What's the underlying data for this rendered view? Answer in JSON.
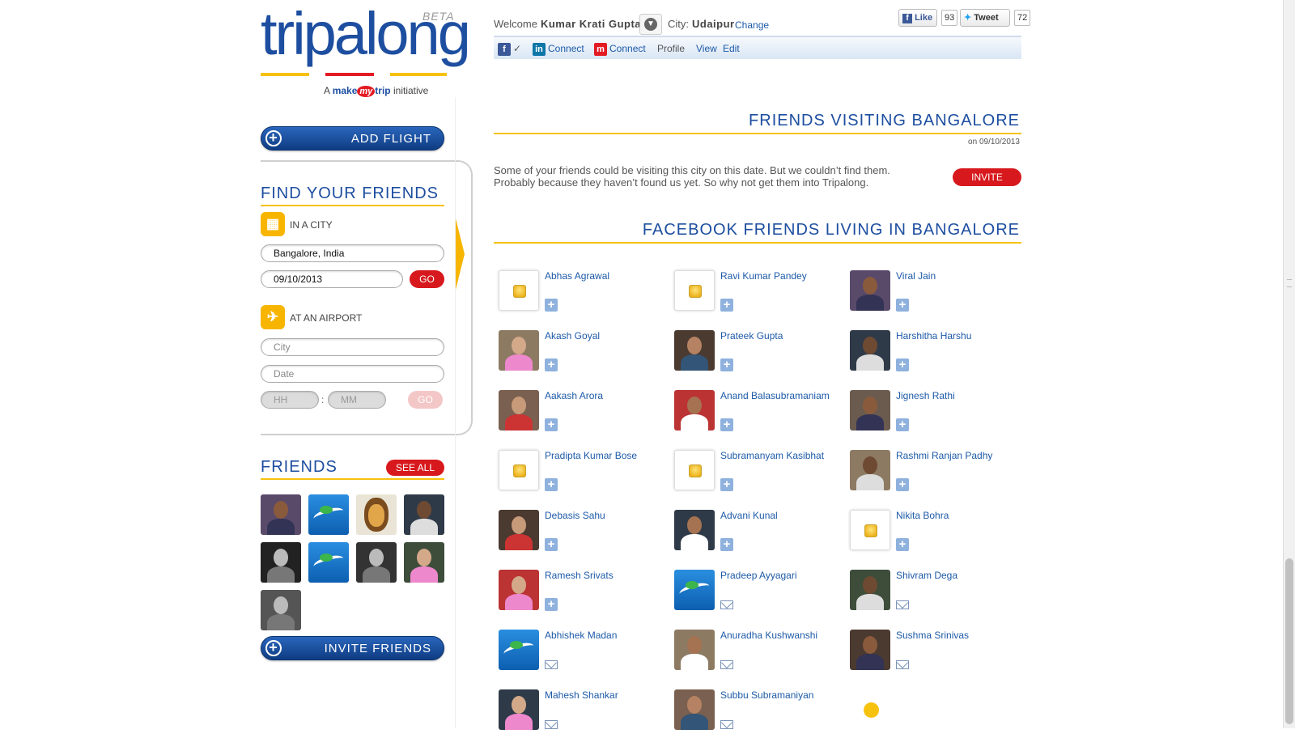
{
  "logo": {
    "word": "tripalong",
    "beta": "BETA",
    "tag_prefix": "A",
    "tag_make": "make",
    "tag_my": "my",
    "tag_trip": "trip",
    "tag_suffix": "initiative"
  },
  "colors": {
    "brand_blue": "#1d4ea0",
    "accent_yellow": "#f7c20e",
    "action_red": "#d7191d"
  },
  "sidebar": {
    "add_flight": "ADD FLIGHT",
    "find_title": "FIND YOUR FRIENDS",
    "in_city": {
      "label": "IN A CITY",
      "icon": "building-icon",
      "city_value": "Bangalore, India",
      "date_value": "09/10/2013",
      "go": "GO"
    },
    "at_airport": {
      "label": "AT AN AIRPORT",
      "icon": "airplane-icon",
      "city_placeholder": "City",
      "date_placeholder": "Date",
      "hh_placeholder": "HH",
      "mm_placeholder": "MM",
      "colon": ":",
      "go": "GO"
    },
    "friends_title": "FRIENDS",
    "see_all": "SEE ALL",
    "invite_friends": "INVITE FRIENDS",
    "friend_thumbs": [
      "photo",
      "tripalong-logo",
      "lion-cartoon",
      "photo",
      "photo-bw",
      "tripalong-logo",
      "photo-bw",
      "photo",
      "photo-bald"
    ]
  },
  "header": {
    "welcome": "Welcome",
    "user_name": "Kumar Krati Gupta",
    "city_label": "City:",
    "city_value": "Udaipur",
    "change": "Change",
    "like": "Like",
    "like_count": "93",
    "tweet": "Tweet",
    "tweet_count": "72",
    "check": "✓",
    "connect_linkedin": "Connect",
    "connect_mmt": "Connect",
    "profile": "Profile",
    "view": "View",
    "edit": "Edit"
  },
  "visiting": {
    "title": "FRIENDS VISITING BANGALORE",
    "on_date": "on 09/10/2013",
    "message": "Some of your friends could be visiting this city on this date. But we couldn’t find them. Probably because they haven’t found us yet. So why not get them into Tripalong.",
    "invite": "INVITE"
  },
  "living": {
    "title": "FACEBOOK FRIENDS LIVING IN BANGALORE",
    "friends": [
      {
        "name": "Abhas Agrawal",
        "pic": "empty",
        "action": "add"
      },
      {
        "name": "Ravi Kumar Pandey",
        "pic": "empty",
        "action": "add"
      },
      {
        "name": "Viral Jain",
        "pic": "photo",
        "action": "add"
      },
      {
        "name": "Akash Goyal",
        "pic": "photo",
        "action": "add"
      },
      {
        "name": "Prateek Gupta",
        "pic": "photo",
        "action": "add"
      },
      {
        "name": "Harshitha Harshu",
        "pic": "photo",
        "action": "add"
      },
      {
        "name": "Aakash Arora",
        "pic": "photo",
        "action": "add"
      },
      {
        "name": "Anand Balasubramaniam",
        "pic": "photo",
        "action": "add"
      },
      {
        "name": "Jignesh Rathi",
        "pic": "photo",
        "action": "add"
      },
      {
        "name": "Pradipta Kumar Bose",
        "pic": "empty",
        "action": "add"
      },
      {
        "name": "Subramanyam Kasibhat",
        "pic": "empty",
        "action": "add"
      },
      {
        "name": "Rashmi Ranjan Padhy",
        "pic": "photo",
        "action": "add"
      },
      {
        "name": "Debasis Sahu",
        "pic": "photo",
        "action": "add"
      },
      {
        "name": "Advani Kunal",
        "pic": "photo",
        "action": "add"
      },
      {
        "name": "Nikita Bohra",
        "pic": "empty",
        "action": "add"
      },
      {
        "name": "Ramesh Srivats",
        "pic": "photo",
        "action": "add"
      },
      {
        "name": "Pradeep Ayyagari",
        "pic": "tripalong-logo",
        "action": "mail"
      },
      {
        "name": "Shivram Dega",
        "pic": "photo",
        "action": "mail"
      },
      {
        "name": "Abhishek Madan",
        "pic": "tripalong-logo",
        "action": "mail"
      },
      {
        "name": "Anuradha Kushwanshi",
        "pic": "photo",
        "action": "mail"
      },
      {
        "name": "Sushma Srinivas",
        "pic": "photo",
        "action": "mail"
      },
      {
        "name": "Mahesh Shankar",
        "pic": "photo",
        "action": "mail"
      },
      {
        "name": "Subbu Subramaniyan",
        "pic": "photo",
        "action": "mail"
      }
    ]
  }
}
